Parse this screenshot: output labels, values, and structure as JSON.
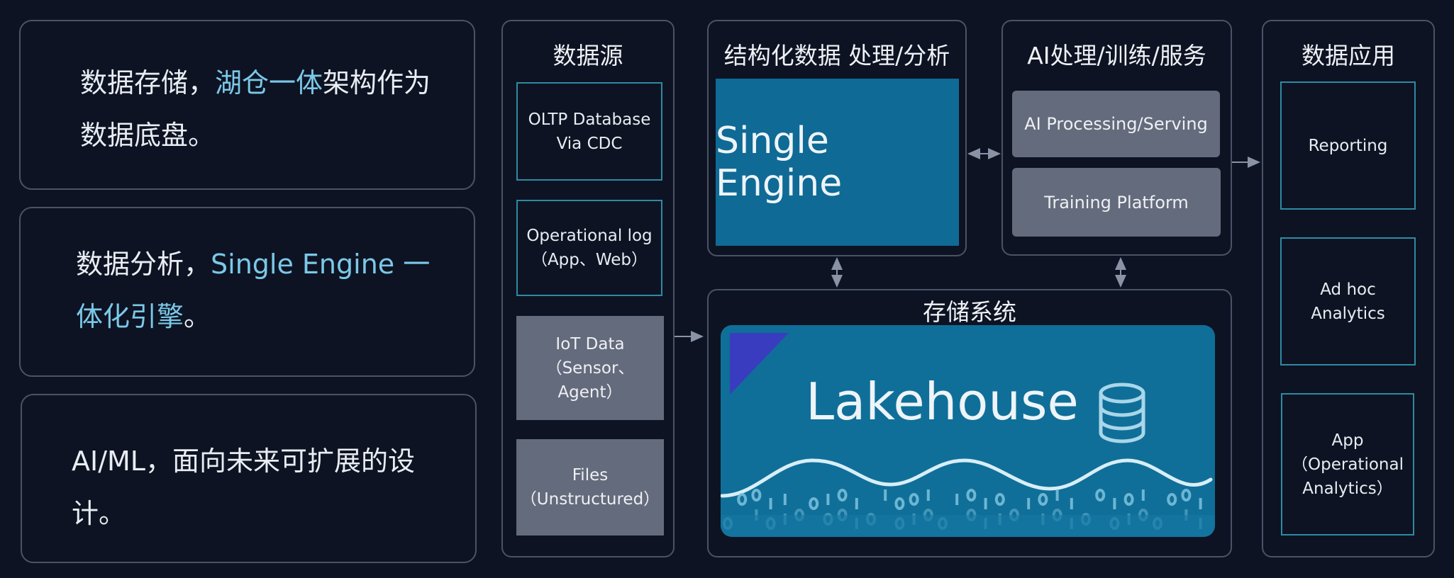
{
  "features": [
    {
      "parts": [
        {
          "text": "数据存储，",
          "highlight": false
        },
        {
          "text": "湖仓一体",
          "highlight": true
        },
        {
          "text": "架构作为数据底盘。",
          "highlight": false
        }
      ]
    },
    {
      "parts": [
        {
          "text": "数据分析，",
          "highlight": false
        },
        {
          "text": "Single Engine 一体化引擎",
          "highlight": true
        },
        {
          "text": "。",
          "highlight": false
        }
      ]
    },
    {
      "parts": [
        {
          "text": "AI/ML，面向未来可扩展的设计。",
          "highlight": false
        }
      ]
    }
  ],
  "sources": {
    "title": "数据源",
    "items": [
      {
        "label": "OLTP Database\nVia CDC",
        "style": "outline"
      },
      {
        "label": "Operational log\n（App、Web）",
        "style": "outline"
      },
      {
        "label": "IoT Data\n（Sensor、\nAgent）",
        "style": "filled"
      },
      {
        "label": "Files\n（Unstructured）",
        "style": "filled"
      }
    ]
  },
  "processing": {
    "title": "结构化数据 处理/分析",
    "engine_label": "Single Engine"
  },
  "ai": {
    "title": "AI处理/训练/服务",
    "items": [
      "AI Processing/Serving",
      "Training Platform"
    ]
  },
  "storage": {
    "title": "存储系统",
    "lakehouse_label": "Lakehouse",
    "icon": "database-icon"
  },
  "apps": {
    "title": "数据应用",
    "items": [
      "Reporting",
      "Ad hoc\nAnalytics",
      "App\n（Operational\nAnalytics）"
    ]
  },
  "colors": {
    "background": "#0d1322",
    "highlight": "#7cc8e8",
    "engine_blue": "#0f6a96",
    "lakehouse_blue": "#0f6f99",
    "gray_box": "#646b7c",
    "teal_border": "#2f8aa4",
    "accent_triangle": "#3a3cbf"
  }
}
